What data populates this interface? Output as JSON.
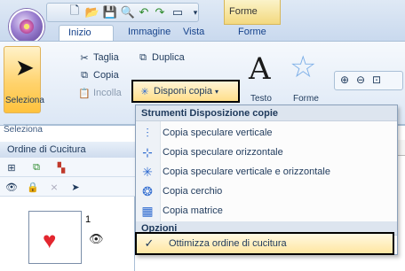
{
  "title_bar": {
    "context_tab": "Forme"
  },
  "ribbon_tabs": [
    "Inizio",
    "Immagine",
    "Vista",
    "Forme"
  ],
  "ribbon": {
    "seleziona_label": "Seleziona",
    "group_seleziona": "Seleziona",
    "taglia": "Taglia",
    "copia": "Copia",
    "incolla": "Incolla",
    "duplica": "Duplica",
    "disponi_copia": "Disponi copia",
    "testo": "Testo",
    "forme": "Forme"
  },
  "pane": {
    "title": "Ordine di Cucitura",
    "item_number": "1"
  },
  "menu": {
    "header_strumenti": "Strumenti Disposizione copie",
    "items": [
      {
        "label": "Copia speculare verticale",
        "icon": "mirror-vertical-icon"
      },
      {
        "label": "Copia speculare orizzontale",
        "icon": "mirror-horizontal-icon"
      },
      {
        "label": "Copia speculare verticale e orizzontale",
        "icon": "mirror-both-icon"
      },
      {
        "label": "Copia cerchio",
        "icon": "circle-copy-icon"
      },
      {
        "label": "Copia matrice",
        "icon": "matrix-copy-icon"
      }
    ],
    "header_opzioni": "Opzioni",
    "option_label": "Ottimizza ordine di cucitura",
    "option_checked": "✓"
  },
  "colors": {
    "accent": "#ffd36d",
    "heart": "#e3262f",
    "menu_icon": "#2f6bd0"
  }
}
